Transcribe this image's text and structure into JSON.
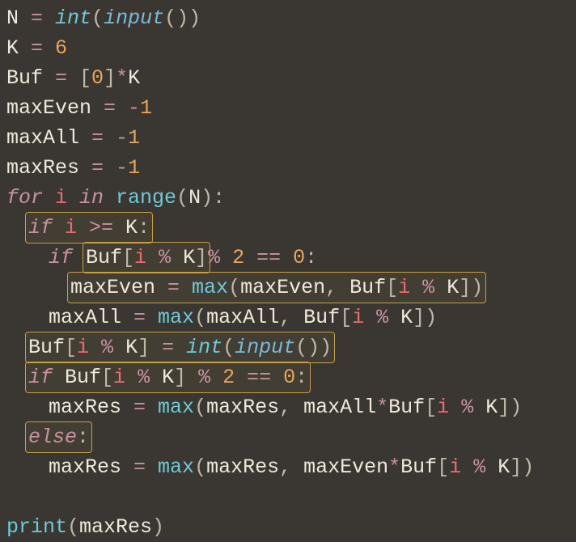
{
  "code": {
    "l1": {
      "a": "N ",
      "b": "= ",
      "c": "int",
      "d": "(",
      "e": "input",
      "f": "())"
    },
    "l2": {
      "a": "K ",
      "b": "= ",
      "c": "6"
    },
    "l3": {
      "a": "Buf ",
      "b": "= ",
      "c": "[",
      "d": "0",
      "e": "]",
      "f": "*",
      "g": "K"
    },
    "l4": {
      "a": "maxEven ",
      "b": "= ",
      "c": "-",
      "d": "1"
    },
    "l5": {
      "a": "maxAll ",
      "b": "= ",
      "c": "-",
      "d": "1"
    },
    "l6": {
      "a": "maxRes ",
      "b": "= ",
      "c": "-",
      "d": "1"
    },
    "l7": {
      "a": "for ",
      "b": "i ",
      "c": "in ",
      "d": "range",
      "e": "(",
      "f": "N",
      "g": "):"
    },
    "l8": {
      "a": "if ",
      "b": "i ",
      "c": ">= ",
      "d": "K",
      "e": ":"
    },
    "l9": {
      "a": "if ",
      "b": "Buf",
      "c": "[",
      "d": "i ",
      "e": "% ",
      "f": "K",
      "g": "] ",
      "h": "% ",
      "i": "2 ",
      "j": "== ",
      "k": "0",
      "l": ":"
    },
    "l10": {
      "a": "maxEven ",
      "b": "= ",
      "c": "max",
      "d": "(",
      "e": "maxEven",
      "f": ", ",
      "g": "Buf",
      "h": "[",
      "i": "i ",
      "j": "% ",
      "k": "K",
      "l": "])"
    },
    "l11": {
      "a": "maxAll ",
      "b": "= ",
      "c": "max",
      "d": "(",
      "e": "maxAll",
      "f": ", ",
      "g": "Buf",
      "h": "[",
      "i": "i ",
      "j": "% ",
      "k": "K",
      "l": "])"
    },
    "l12": {
      "a": "Buf",
      "b": "[",
      "c": "i ",
      "d": "% ",
      "e": "K",
      "f": "] ",
      "g": "= ",
      "h": "int",
      "i": "(",
      "j": "input",
      "k": "())"
    },
    "l13": {
      "a": "if ",
      "b": "Buf",
      "c": "[",
      "d": "i ",
      "e": "% ",
      "f": "K",
      "g": "] ",
      "h": "% ",
      "i": "2 ",
      "j": "== ",
      "k": "0",
      "l": ":"
    },
    "l14": {
      "a": "maxRes ",
      "b": "= ",
      "c": "max",
      "d": "(",
      "e": "maxRes",
      "f": ", ",
      "g": "maxAll",
      "h": "*",
      "i": "Buf",
      "j": "[",
      "k": "i ",
      "l": "% ",
      "m": "K",
      "n": "])"
    },
    "l15": {
      "a": "else",
      "b": ":"
    },
    "l16": {
      "a": "maxRes ",
      "b": "= ",
      "c": "max",
      "d": "(",
      "e": "maxRes",
      "f": ", ",
      "g": "maxEven",
      "h": "*",
      "i": "Buf",
      "j": "[",
      "k": "i ",
      "l": "% ",
      "m": "K",
      "n": "])"
    },
    "l17": {
      "a": "print",
      "b": "(",
      "c": "maxRes",
      "d": ")"
    }
  }
}
